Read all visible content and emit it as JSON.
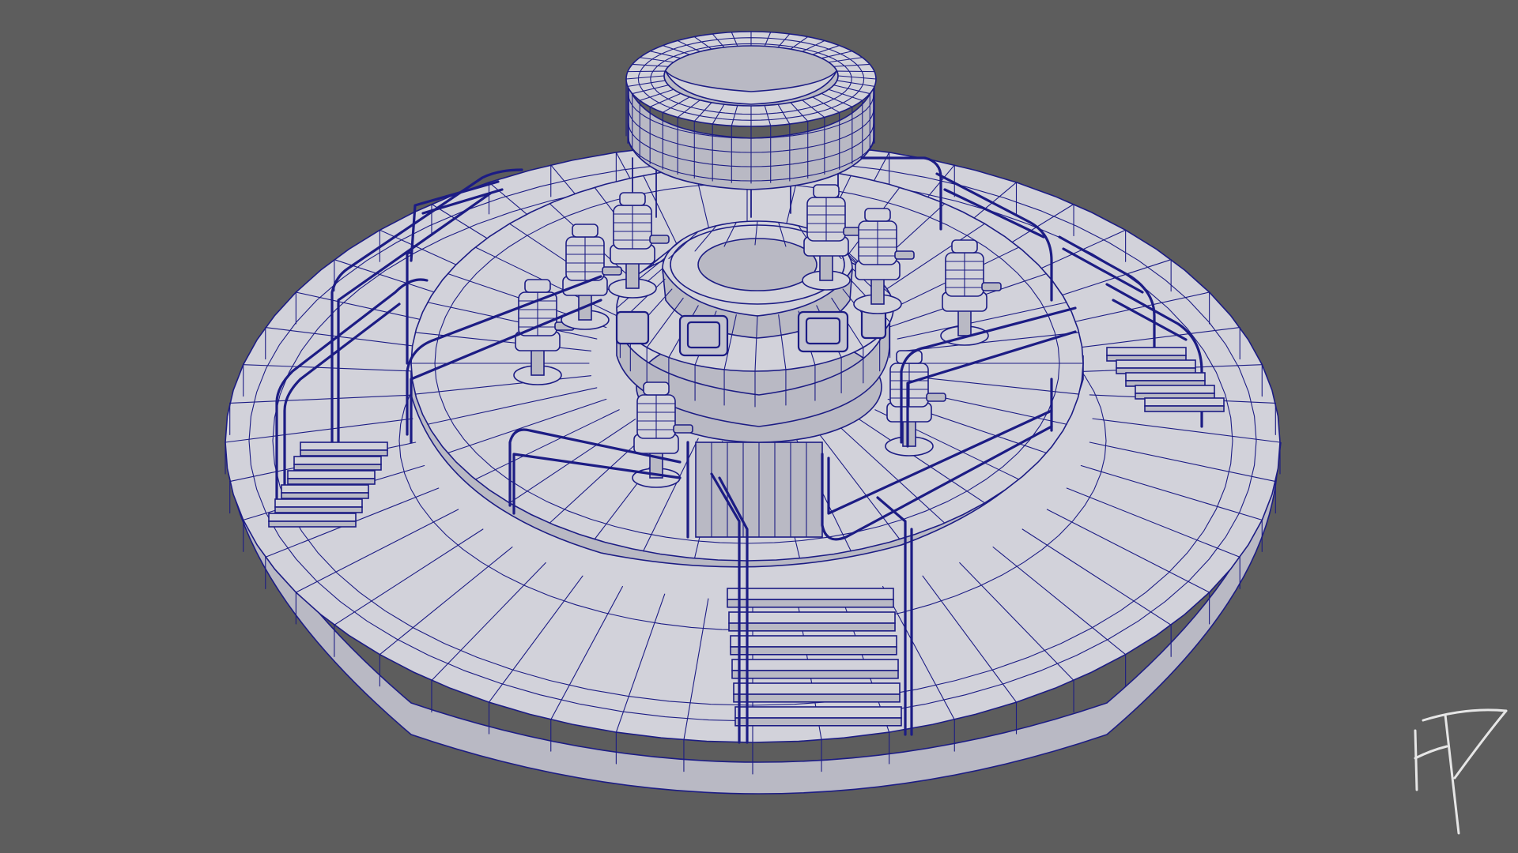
{
  "viewport": {
    "background_color": "#5d5d5d",
    "mesh_surface_color": "#d2d2da",
    "wireframe_color": "#1c1c84",
    "signature_color": "#e6e6e6"
  },
  "model": {
    "base_disc_radial_segments": 48,
    "upper_ring_radial_segments": 40,
    "chairs": 8,
    "console_screens": 4,
    "staircases": 3
  },
  "signature": {
    "icon": "artist-monogram-signature",
    "text": "HT"
  }
}
